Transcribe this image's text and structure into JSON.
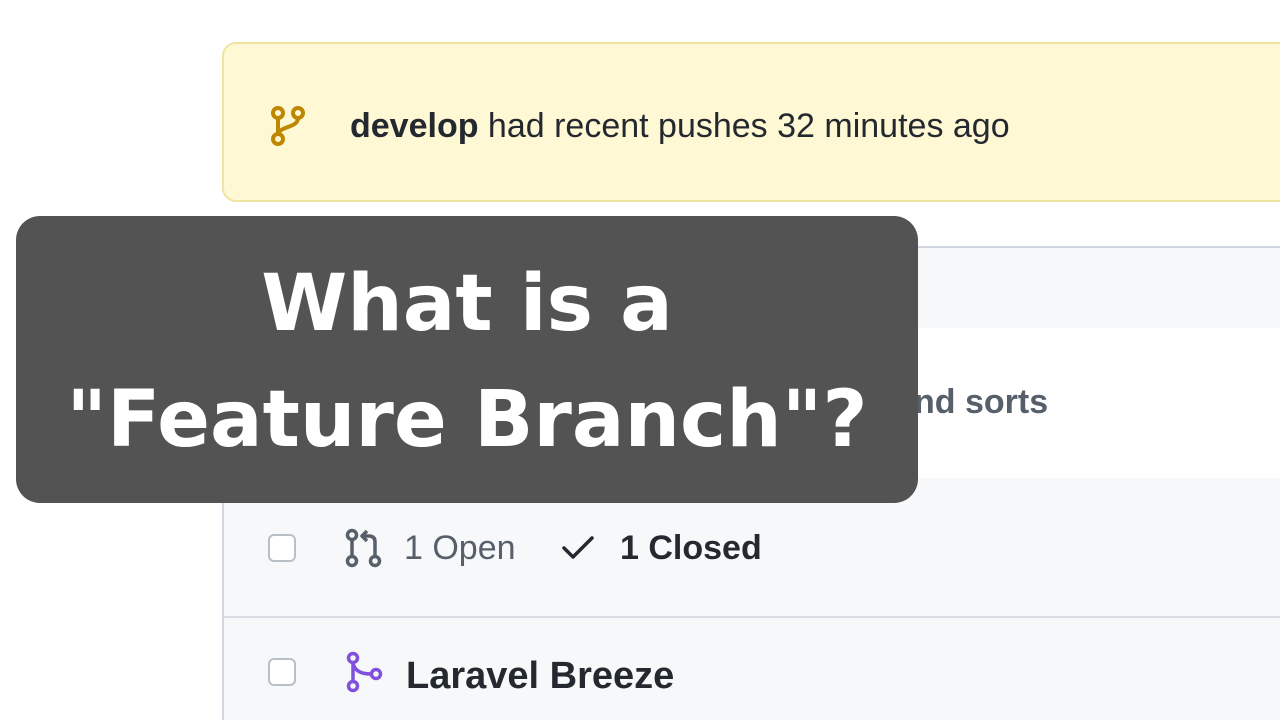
{
  "banner": {
    "branch_name": "develop",
    "message": " had recent pushes 32 minutes ago",
    "icon": "git-branch-icon"
  },
  "list": {
    "filter_text": "nd sorts",
    "state": {
      "open_label": "1 Open",
      "closed_label": "1 Closed",
      "open_icon": "git-pull-request-icon",
      "closed_icon": "check-icon"
    },
    "items": [
      {
        "title": "Laravel Breeze",
        "icon": "git-merge-icon"
      }
    ]
  },
  "overlay": {
    "line1": "What is a",
    "line2": "\"Feature Branch\"?"
  },
  "colors": {
    "banner_bg": "#fff8d5",
    "banner_icon": "#bf8700",
    "merged_purple": "#8250df",
    "overlay_bg": "#535353",
    "text_dark": "#24292f",
    "text_muted": "#57606a"
  }
}
